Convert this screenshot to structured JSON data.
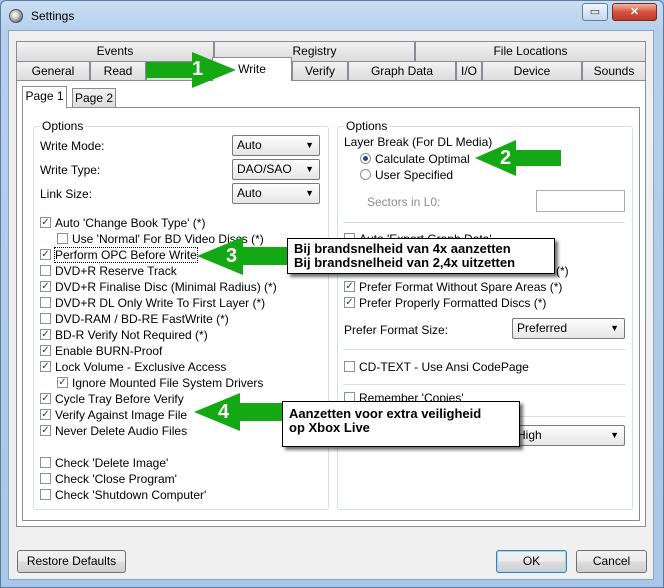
{
  "window": {
    "title": "Settings",
    "icons": [
      "settings-app-icon",
      "restore-icon",
      "close-icon"
    ]
  },
  "tabs": {
    "row1": [
      "Events",
      "Registry",
      "File Locations"
    ],
    "row2": [
      "General",
      "Read",
      "",
      "Write",
      "Verify",
      "Graph Data",
      "I/O",
      "Device",
      "Sounds"
    ],
    "active": "Write"
  },
  "subtabs": [
    "Page 1",
    "Page 2"
  ],
  "left": {
    "group_title": "Options",
    "write_mode_label": "Write Mode:",
    "write_mode_value": "Auto",
    "write_type_label": "Write Type:",
    "write_type_value": "DAO/SAO",
    "link_size_label": "Link Size:",
    "link_size_value": "Auto",
    "checkboxes": [
      {
        "label": "Auto 'Change Book Type' (*)",
        "checked": true
      },
      {
        "label": "Use 'Normal' For BD Video Discs (*)",
        "checked": false
      },
      {
        "label": "Perform OPC Before Write",
        "checked": true
      },
      {
        "label": "DVD+R Reserve Track",
        "checked": false
      },
      {
        "label": "DVD+R Finalise Disc (Minimal Radius) (*)",
        "checked": true
      },
      {
        "label": "DVD+R DL Only Write To First Layer (*)",
        "checked": false
      },
      {
        "label": "DVD-RAM / BD-RE FastWrite (*)",
        "checked": false
      },
      {
        "label": "BD-R Verify Not Required (*)",
        "checked": true
      },
      {
        "label": "Enable BURN-Proof",
        "checked": true
      },
      {
        "label": "Lock Volume - Exclusive Access",
        "checked": true
      },
      {
        "label": "Ignore Mounted File System Drivers",
        "checked": true
      },
      {
        "label": "Cycle Tray Before Verify",
        "checked": true
      },
      {
        "label": "Verify Against Image File",
        "checked": true
      },
      {
        "label": "Never Delete Audio Files",
        "checked": true
      },
      {
        "label": "Check 'Delete Image'",
        "checked": false
      },
      {
        "label": "Check 'Close Program'",
        "checked": false
      },
      {
        "label": "Check 'Shutdown Computer'",
        "checked": false
      }
    ]
  },
  "right": {
    "group_title": "Options",
    "layer_break_label": "Layer Break (For DL Media)",
    "radio_calc": "Calculate Optimal",
    "radio_user": "User Specified",
    "sectors_label": "Sectors in L0:",
    "auto_export_label": "Auto 'Export Graph Data'",
    "hidden_suffix": "(*)",
    "prefer_spare": "Prefer Format Without Spare Areas (*)",
    "prefer_formatted": "Prefer Properly Formatted Discs (*)",
    "prefer_format_size_label": "Prefer Format Size:",
    "prefer_format_size_value": "Preferred",
    "cdtext_label": "CD-TEXT - Use Ansi CodePage",
    "remember_label": "Remember 'Copies'",
    "priority_value": "High"
  },
  "buttons": {
    "restore": "Restore Defaults",
    "ok": "OK",
    "cancel": "Cancel"
  },
  "annotations": {
    "numbers": [
      "1",
      "2",
      "3",
      "4"
    ],
    "callout3_line1": "Bij brandsnelheid van 4x aanzetten",
    "callout3_line2": "Bij brandsnelheid van 2,4x uitzetten",
    "callout4_line1": "Aanzetten voor extra veiligheid",
    "callout4_line2": "op Xbox Live",
    "arrow_color": "#14a814"
  }
}
